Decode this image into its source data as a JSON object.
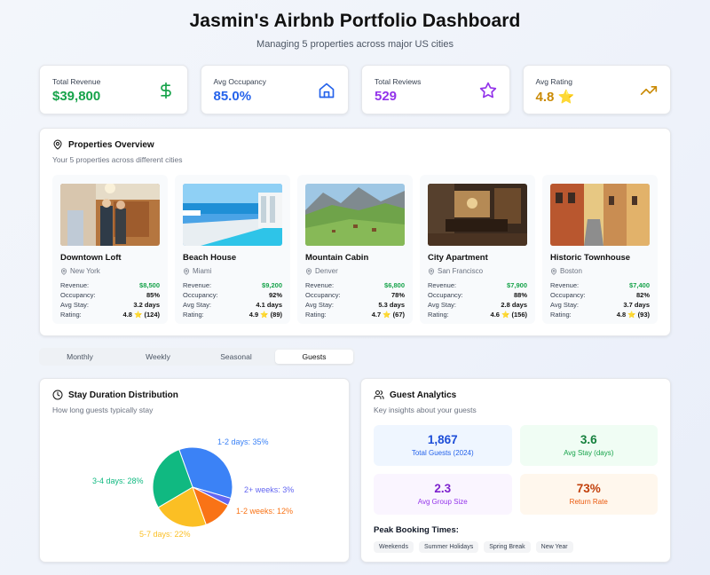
{
  "header": {
    "title": "Jasmin's Airbnb Portfolio Dashboard",
    "subtitle": "Managing 5 properties across major US cities"
  },
  "stats": [
    {
      "label": "Total Revenue",
      "value": "$39,800",
      "color": "#16a34a",
      "icon": "dollar-icon"
    },
    {
      "label": "Avg Occupancy",
      "value": "85.0%",
      "color": "#2563eb",
      "icon": "home-icon"
    },
    {
      "label": "Total Reviews",
      "value": "529",
      "color": "#9333ea",
      "icon": "star-icon"
    },
    {
      "label": "Avg Rating",
      "value": "4.8 ⭐",
      "color": "#ca8a04",
      "icon": "trending-up-icon"
    }
  ],
  "properties_section": {
    "title": "Properties Overview",
    "subtitle": "Your 5 properties across different cities",
    "row_labels": {
      "revenue": "Revenue:",
      "occupancy": "Occupancy:",
      "avg_stay": "Avg Stay:",
      "rating": "Rating:"
    },
    "items": [
      {
        "name": "Downtown Loft",
        "location": "New York",
        "revenue": "$8,500",
        "occupancy": "85%",
        "avg_stay": "3.2 days",
        "rating": "4.8 ⭐ (124)",
        "image": "loft-interior-photo"
      },
      {
        "name": "Beach House",
        "location": "Miami",
        "revenue": "$9,200",
        "occupancy": "92%",
        "avg_stay": "4.1 days",
        "rating": "4.9 ⭐ (89)",
        "image": "beach-pool-photo"
      },
      {
        "name": "Mountain Cabin",
        "location": "Denver",
        "revenue": "$6,800",
        "occupancy": "78%",
        "avg_stay": "5.3 days",
        "rating": "4.7 ⭐ (67)",
        "image": "mountain-valley-photo"
      },
      {
        "name": "City Apartment",
        "location": "San Francisco",
        "revenue": "$7,900",
        "occupancy": "88%",
        "avg_stay": "2.8 days",
        "rating": "4.6 ⭐ (156)",
        "image": "apartment-interior-photo"
      },
      {
        "name": "Historic Townhouse",
        "location": "Boston",
        "revenue": "$7,400",
        "occupancy": "82%",
        "avg_stay": "3.7 days",
        "rating": "4.8 ⭐ (93)",
        "image": "townhouse-street-photo"
      }
    ]
  },
  "tabs": [
    {
      "label": "Monthly",
      "active": false
    },
    {
      "label": "Weekly",
      "active": false
    },
    {
      "label": "Seasonal",
      "active": false
    },
    {
      "label": "Guests",
      "active": true
    }
  ],
  "stay_panel": {
    "title": "Stay Duration Distribution",
    "subtitle": "How long guests typically stay",
    "chart_data": {
      "type": "pie",
      "slices": [
        {
          "label": "1-2 days",
          "value": 35,
          "color": "#3b82f6"
        },
        {
          "label": "2+ weeks",
          "value": 3,
          "color": "#6366f1"
        },
        {
          "label": "1-2 weeks",
          "value": 12,
          "color": "#f97316"
        },
        {
          "label": "5-7 days",
          "value": 22,
          "color": "#fbbf24"
        },
        {
          "label": "3-4 days",
          "value": 28,
          "color": "#10b981"
        }
      ],
      "label_texts": [
        "1-2 days: 35%",
        "2+ weeks: 3%",
        "1-2 weeks: 12%",
        "5-7 days: 22%",
        "3-4 days: 28%"
      ]
    }
  },
  "guest_panel": {
    "title": "Guest Analytics",
    "subtitle": "Key insights about your guests",
    "metrics": [
      {
        "value": "1,867",
        "label": "Total Guests (2024)",
        "color": "#1d4ed8",
        "bg": "#eff6ff"
      },
      {
        "value": "3.6",
        "label": "Avg Stay (days)",
        "color": "#15803d",
        "bg": "#f0fdf4"
      },
      {
        "value": "2.3",
        "label": "Avg Group Size",
        "color": "#7e22ce",
        "bg": "#faf5ff"
      },
      {
        "value": "73%",
        "label": "Return Rate",
        "color": "#c2410c",
        "bg": "#fff7ed"
      }
    ],
    "peak_title": "Peak Booking Times:",
    "peak_times": [
      "Weekends",
      "Summer Holidays",
      "Spring Break",
      "New Year"
    ]
  }
}
